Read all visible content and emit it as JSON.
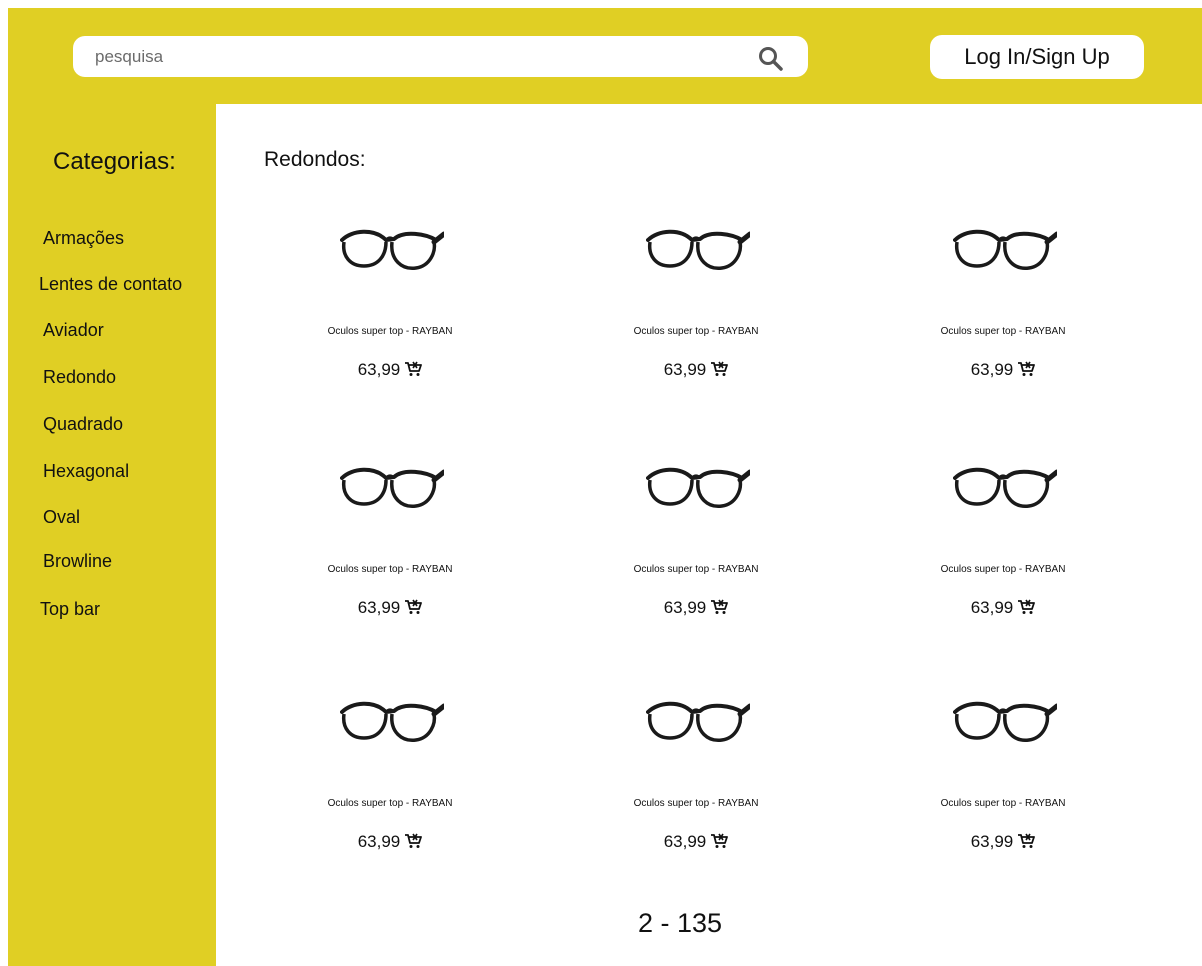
{
  "header": {
    "search_placeholder": "pesquisa",
    "login_label": "Log In/Sign Up"
  },
  "sidebar": {
    "title": "Categorias:",
    "items": [
      {
        "label": "Armações"
      },
      {
        "label": "Lentes de contato"
      },
      {
        "label": "Aviador"
      },
      {
        "label": "Redondo"
      },
      {
        "label": "Quadrado"
      },
      {
        "label": "Hexagonal"
      },
      {
        "label": "Oval"
      },
      {
        "label": "Browline"
      },
      {
        "label": "Top bar"
      }
    ]
  },
  "main": {
    "section_title": "Redondos:",
    "products": [
      {
        "name": "Oculos super top - RAYBAN",
        "price": "63,99"
      },
      {
        "name": "Oculos super top - RAYBAN",
        "price": "63,99"
      },
      {
        "name": "Oculos super top - RAYBAN",
        "price": "63,99"
      },
      {
        "name": "Oculos super top - RAYBAN",
        "price": "63,99"
      },
      {
        "name": "Oculos super top - RAYBAN",
        "price": "63,99"
      },
      {
        "name": "Oculos super top - RAYBAN",
        "price": "63,99"
      },
      {
        "name": "Oculos super top - RAYBAN",
        "price": "63,99"
      },
      {
        "name": "Oculos super top - RAYBAN",
        "price": "63,99"
      },
      {
        "name": "Oculos super top - RAYBAN",
        "price": "63,99"
      }
    ],
    "pagination": "2 - 135"
  },
  "icons": {
    "search": "search-icon",
    "cart": "cart-icon",
    "product_image": "glasses-icon"
  },
  "colors": {
    "brand_yellow": "#e0cf24",
    "content_bg": "#ffffff",
    "text": "#111111"
  }
}
